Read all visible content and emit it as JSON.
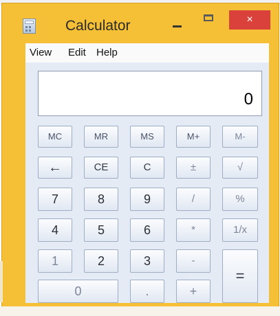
{
  "window": {
    "title": "Calculator",
    "close_label": "×",
    "icon": "calculator-icon",
    "frame_color": "#f5c036",
    "close_color": "#d9413a"
  },
  "menu": {
    "items": [
      "View",
      "Edit",
      "Help"
    ]
  },
  "display": {
    "value": "0"
  },
  "memory_keys": [
    "MC",
    "MR",
    "MS",
    "M+",
    "M-"
  ],
  "row2": [
    "←",
    "CE",
    "C",
    "±",
    "√"
  ],
  "row3": [
    "7",
    "8",
    "9",
    "/",
    "%"
  ],
  "row4": [
    "4",
    "5",
    "6",
    "*",
    "1/x"
  ],
  "row5": [
    "1",
    "2",
    "3",
    "-"
  ],
  "row6": [
    "0",
    ".",
    "+"
  ],
  "equals": "="
}
